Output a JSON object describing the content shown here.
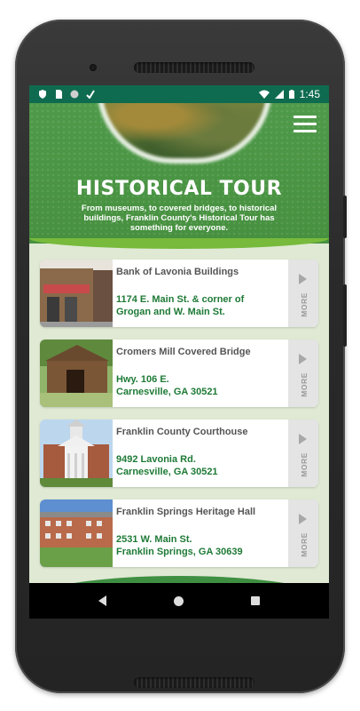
{
  "status_bar": {
    "time": "1:45",
    "left_icons": [
      "shield-icon",
      "sim-card-icon",
      "circle-icon",
      "download-check-icon"
    ],
    "right_icons": [
      "wifi-icon",
      "signal-icon",
      "battery-icon"
    ],
    "color": "#0f6b4f"
  },
  "header": {
    "title": "HISTORICAL TOUR",
    "subtitle": "From museums, to covered bridges, to historical buildings, Franklin County's Historical Tour has something for everyone.",
    "menu_icon": "hamburger-menu-icon",
    "color": "#4f9a4a",
    "accent": "#77ba3c"
  },
  "tours": [
    {
      "title": "Bank of Lavonia Buildings",
      "address_line1": "1174 E. Main St. & corner of",
      "address_line2": "Grogan and W. Main St.",
      "more_label": "MORE"
    },
    {
      "title": "Cromers Mill Covered Bridge",
      "address_line1": "Hwy. 106 E.",
      "address_line2": "Carnesville, GA 30521",
      "more_label": "MORE"
    },
    {
      "title": "Franklin County Courthouse",
      "address_line1": "9492 Lavonia Rd.",
      "address_line2": "Carnesville, GA 30521",
      "more_label": "MORE"
    },
    {
      "title": "Franklin Springs Heritage Hall",
      "address_line1": "2531 W. Main St.",
      "address_line2": "Franklin Springs, GA 30639",
      "more_label": "MORE"
    }
  ],
  "address_color": "#1e7a36",
  "nav_bar": {
    "buttons": [
      "back-icon",
      "home-icon",
      "recent-apps-icon"
    ]
  }
}
